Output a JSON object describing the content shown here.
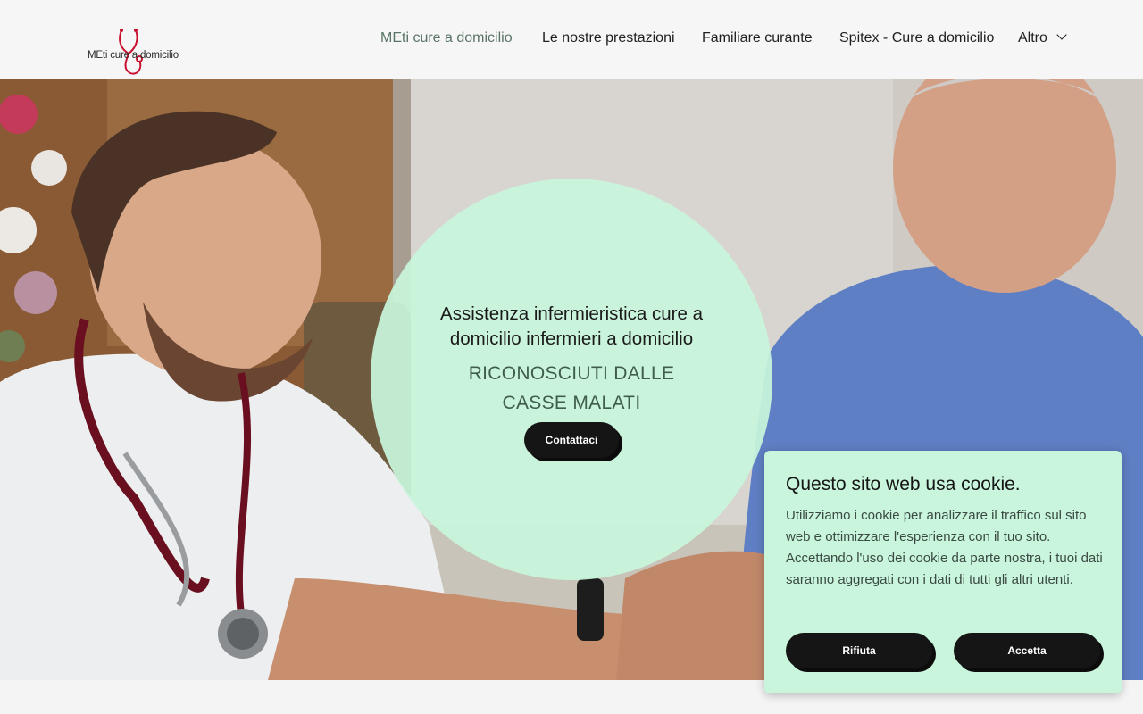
{
  "header": {
    "logo_text": "MEti cure a domicilio",
    "nav": [
      {
        "label": "MEti cure a domicilio",
        "active": true
      },
      {
        "label": "Le nostre prestazioni",
        "active": false
      },
      {
        "label": "Familiare curante",
        "active": false
      },
      {
        "label": "Spitex - Cure a domicilio",
        "active": false
      },
      {
        "label": "Altro",
        "active": false
      }
    ]
  },
  "hero": {
    "title": "Assistenza infermieristica cure a domicilio infermieri a domicilio",
    "subtitle": "RICONOSCIUTI DALLE CASSE MALATI",
    "cta_label": "Contattaci"
  },
  "cookie_banner": {
    "title": "Questo sito web usa cookie.",
    "text": "Utilizziamo i cookie per analizzare il traffico sul sito web e ottimizzare l'esperienza con il tuo sito. Accettando l'uso dei cookie da parte nostra, i tuoi dati saranno aggregati con i dati di tutti gli altri utenti.",
    "reject_label": "Rifiuta",
    "accept_label": "Accetta"
  },
  "colors": {
    "accent": "#c8f5dc",
    "nav_active": "#5a7466",
    "button": "#151515"
  }
}
